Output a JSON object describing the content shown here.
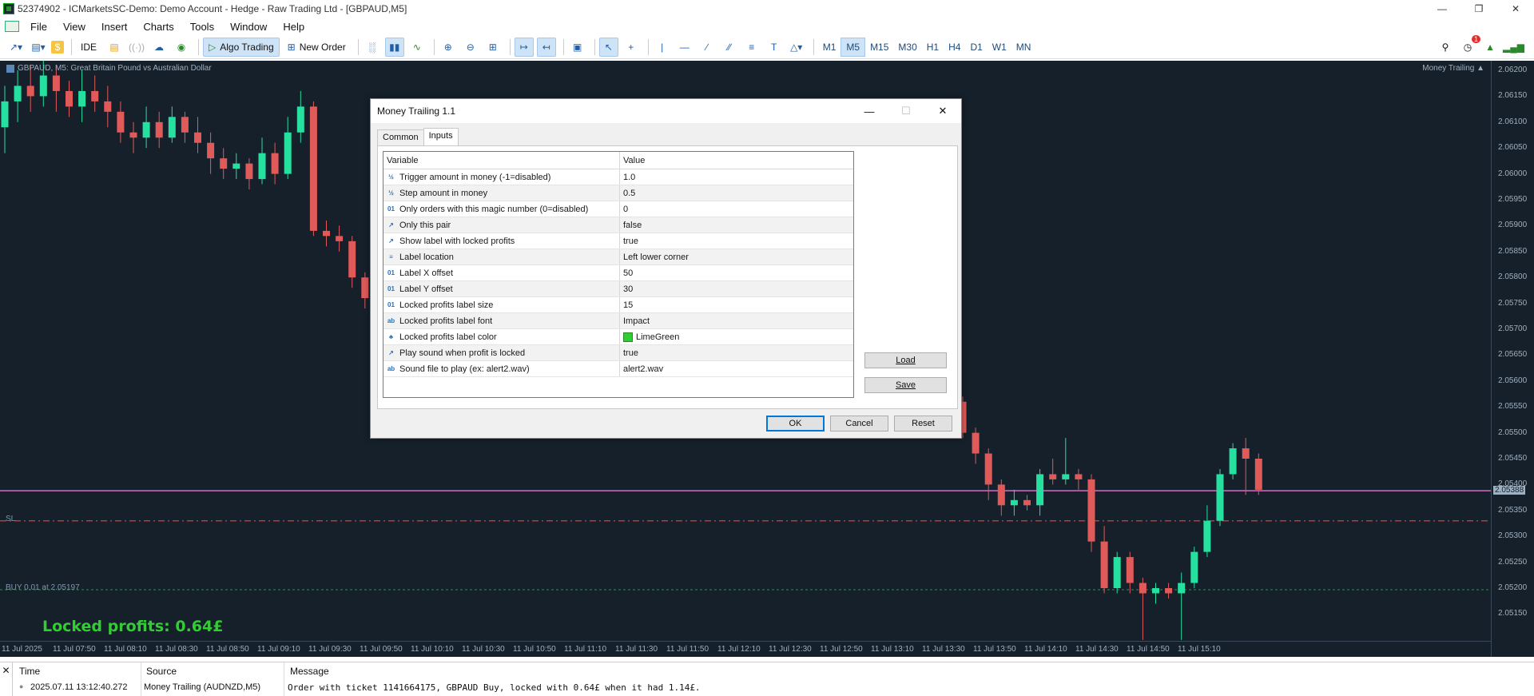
{
  "window": {
    "title": "52374902 - ICMarketsSC-Demo: Demo Account - Hedge - Raw Trading Ltd - [GBPAUD,M5]"
  },
  "menu": [
    "File",
    "View",
    "Insert",
    "Charts",
    "Tools",
    "Window",
    "Help"
  ],
  "toolbar": {
    "ide": "IDE",
    "algo": "Algo Trading",
    "neworder": "New Order",
    "timeframes": [
      "M1",
      "M5",
      "M15",
      "M30",
      "H1",
      "H4",
      "D1",
      "W1",
      "MN"
    ],
    "active_tf": "M5",
    "notifications": "1"
  },
  "chart": {
    "title": "GBPAUD, M5:  Great Britain Pound vs Australian Dollar",
    "ea_name": "Money Trailing",
    "sl_label": "SL",
    "buy_label": "BUY 0.01 at 2.05197",
    "locked_label": "Locked profits: 0.64£",
    "price_labels": [
      "2.06200",
      "2.06150",
      "2.06100",
      "2.06050",
      "2.06000",
      "2.05950",
      "2.05900",
      "2.05850",
      "2.05800",
      "2.05750",
      "2.05700",
      "2.05650",
      "2.05600",
      "2.05550",
      "2.05500",
      "2.05450",
      "2.05400",
      "2.05350",
      "2.05300",
      "2.05250",
      "2.05200",
      "2.05150"
    ],
    "current_price": "2.05388",
    "time_labels": [
      "11 Jul 2025",
      "11 Jul 07:50",
      "11 Jul 08:10",
      "11 Jul 08:30",
      "11 Jul 08:50",
      "11 Jul 09:10",
      "11 Jul 09:30",
      "11 Jul 09:50",
      "11 Jul 10:10",
      "11 Jul 10:30",
      "11 Jul 10:50",
      "11 Jul 11:10",
      "11 Jul 11:30",
      "11 Jul 11:50",
      "11 Jul 12:10",
      "11 Jul 12:30",
      "11 Jul 12:50",
      "11 Jul 13:10",
      "11 Jul 13:30",
      "11 Jul 13:50",
      "11 Jul 14:10",
      "11 Jul 14:30",
      "11 Jul 14:50",
      "11 Jul 15:10"
    ],
    "colors": {
      "bg": "#15202b",
      "bull": "#26e0a0",
      "bear": "#e05a5a",
      "sl": "#c0392b",
      "buy": "#2e8b57",
      "price": "#d070c0"
    }
  },
  "dialog": {
    "title": "Money Trailing 1.1",
    "tabs": [
      "Common",
      "Inputs"
    ],
    "active_tab": "Inputs",
    "headers": {
      "variable": "Variable",
      "value": "Value"
    },
    "rows": [
      {
        "icon": "½",
        "name": "Trigger amount in money (-1=disabled)",
        "value": "1.0"
      },
      {
        "icon": "½",
        "name": "Step amount in money",
        "value": "0.5"
      },
      {
        "icon": "01",
        "name": "Only orders with this magic number (0=disabled)",
        "value": "0"
      },
      {
        "icon": "↗",
        "name": "Only this pair",
        "value": "false"
      },
      {
        "icon": "↗",
        "name": "Show label with locked profits",
        "value": "true"
      },
      {
        "icon": "≡",
        "name": "Label location",
        "value": "Left lower corner"
      },
      {
        "icon": "01",
        "name": "Label X offset",
        "value": "50"
      },
      {
        "icon": "01",
        "name": "Label Y offset",
        "value": "30"
      },
      {
        "icon": "01",
        "name": "Locked profits label size",
        "value": "15"
      },
      {
        "icon": "ab",
        "name": "Locked profits label font",
        "value": "Impact"
      },
      {
        "icon": "♣",
        "name": "Locked profits label color",
        "value": "LimeGreen"
      },
      {
        "icon": "↗",
        "name": "Play sound when profit is locked",
        "value": "true"
      },
      {
        "icon": "ab",
        "name": "Sound file to play (ex: alert2.wav)",
        "value": "alert2.wav"
      }
    ],
    "buttons": {
      "load": "Load",
      "save": "Save",
      "ok": "OK",
      "cancel": "Cancel",
      "reset": "Reset"
    }
  },
  "journal": {
    "headers": {
      "time": "Time",
      "source": "Source",
      "message": "Message"
    },
    "row": {
      "time": "2025.07.11 13:12:40.272",
      "source": "Money Trailing (AUDNZD,M5)",
      "message": "Order with ticket 1141664175, GBPAUD Buy, locked with 0.64£ when it had 1.14£."
    }
  }
}
